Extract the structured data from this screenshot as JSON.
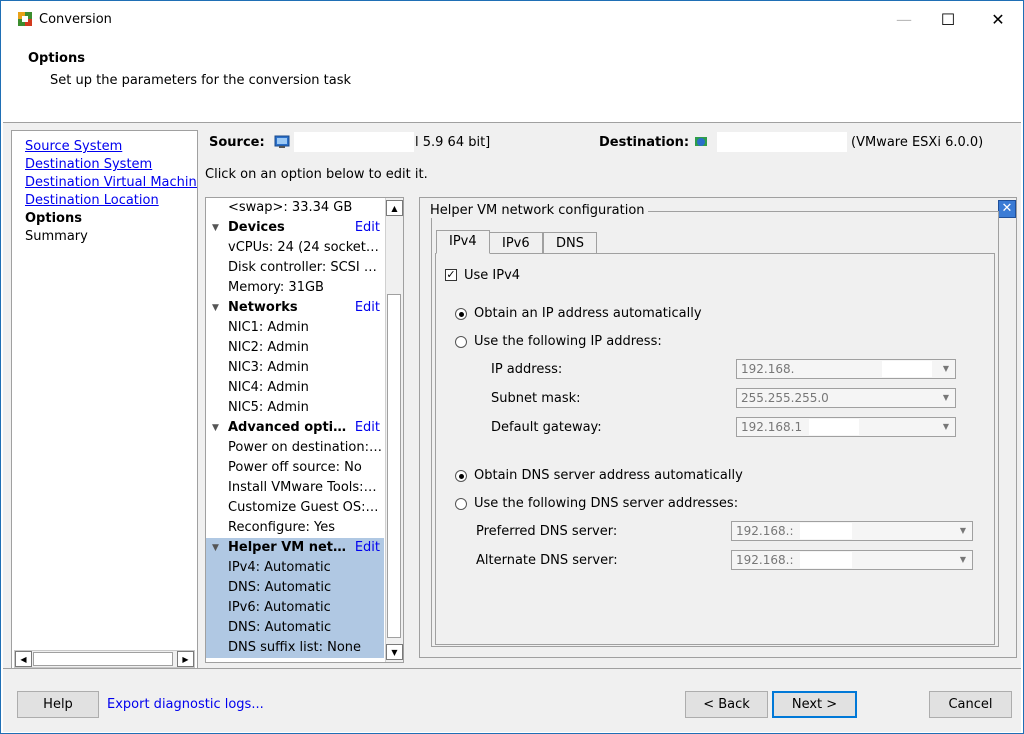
{
  "window": {
    "title": "Conversion",
    "controls": {
      "minimize": "—",
      "maximize": "☐",
      "close": "✕"
    }
  },
  "header": {
    "title": "Options",
    "subtitle": "Set up the parameters for the conversion task"
  },
  "nav": {
    "items": [
      {
        "label": "Source System",
        "link": true
      },
      {
        "label": "Destination System",
        "link": true
      },
      {
        "label": "Destination Virtual Machine",
        "link": true
      },
      {
        "label": "Destination Location",
        "link": true
      },
      {
        "label": "Options",
        "current": true
      },
      {
        "label": "Summary",
        "current": false
      }
    ]
  },
  "info": {
    "source_label": "Source:",
    "source_suffix": "l 5.9 64 bit]",
    "dest_label": "Destination:",
    "dest_suffix": "(VMware ESXi 6.0.0)",
    "instruction": "Click on an option below to edit it."
  },
  "summary": {
    "edit_label": "Edit",
    "rows": [
      {
        "text": "<swap>: 33.34 GB",
        "type": "item"
      },
      {
        "text": "Devices",
        "type": "header"
      },
      {
        "text": "vCPUs: 24 (24 socket…",
        "type": "item"
      },
      {
        "text": "Disk controller: SCSI …",
        "type": "item"
      },
      {
        "text": "Memory: 31GB",
        "type": "item"
      },
      {
        "text": "Networks",
        "type": "header"
      },
      {
        "text": "NIC1: Admin",
        "type": "item"
      },
      {
        "text": "NIC2: Admin",
        "type": "item"
      },
      {
        "text": "NIC3: Admin",
        "type": "item"
      },
      {
        "text": "NIC4: Admin",
        "type": "item"
      },
      {
        "text": "NIC5: Admin",
        "type": "item"
      },
      {
        "text": "Advanced opti…",
        "type": "header"
      },
      {
        "text": "Power on destination:…",
        "type": "item"
      },
      {
        "text": "Power off source: No",
        "type": "item"
      },
      {
        "text": "Install VMware Tools:…",
        "type": "item"
      },
      {
        "text": "Customize Guest OS:…",
        "type": "item"
      },
      {
        "text": "Reconfigure: Yes",
        "type": "item"
      },
      {
        "text": "Helper VM net…",
        "type": "header",
        "selected": true
      },
      {
        "text": "IPv4: Automatic",
        "type": "item",
        "selected": true
      },
      {
        "text": "DNS: Automatic",
        "type": "item",
        "selected": true
      },
      {
        "text": "IPv6: Automatic",
        "type": "item",
        "selected": true
      },
      {
        "text": "DNS: Automatic",
        "type": "item",
        "selected": true
      },
      {
        "text": "DNS suffix list: None",
        "type": "item",
        "selected": true
      }
    ]
  },
  "panel": {
    "group_title": "Helper VM network configuration",
    "tabs": [
      "IPv4",
      "IPv6",
      "DNS"
    ],
    "active_tab": "IPv4",
    "use_ipv4": {
      "label": "Use IPv4",
      "checked": true
    },
    "ip_auto": {
      "label": "Obtain an IP address automatically",
      "selected": true
    },
    "ip_manual": {
      "label": "Use the following IP address:",
      "selected": false
    },
    "ip_address": {
      "label": "IP address:",
      "value": "192.168."
    },
    "subnet_mask": {
      "label": "Subnet mask:",
      "value": "255.255.255.0"
    },
    "default_gateway": {
      "label": "Default gateway:",
      "value": "192.168.1"
    },
    "dns_auto": {
      "label": "Obtain DNS server address automatically",
      "selected": true
    },
    "dns_manual": {
      "label": "Use the following DNS server addresses:",
      "selected": false
    },
    "preferred_dns": {
      "label": "Preferred DNS server:",
      "value": "192.168.:"
    },
    "alternate_dns": {
      "label": "Alternate DNS server:",
      "value": "192.168.:"
    }
  },
  "footer": {
    "help": "Help",
    "export": "Export diagnostic logs...",
    "back": "< Back",
    "next": "Next >",
    "cancel": "Cancel"
  }
}
